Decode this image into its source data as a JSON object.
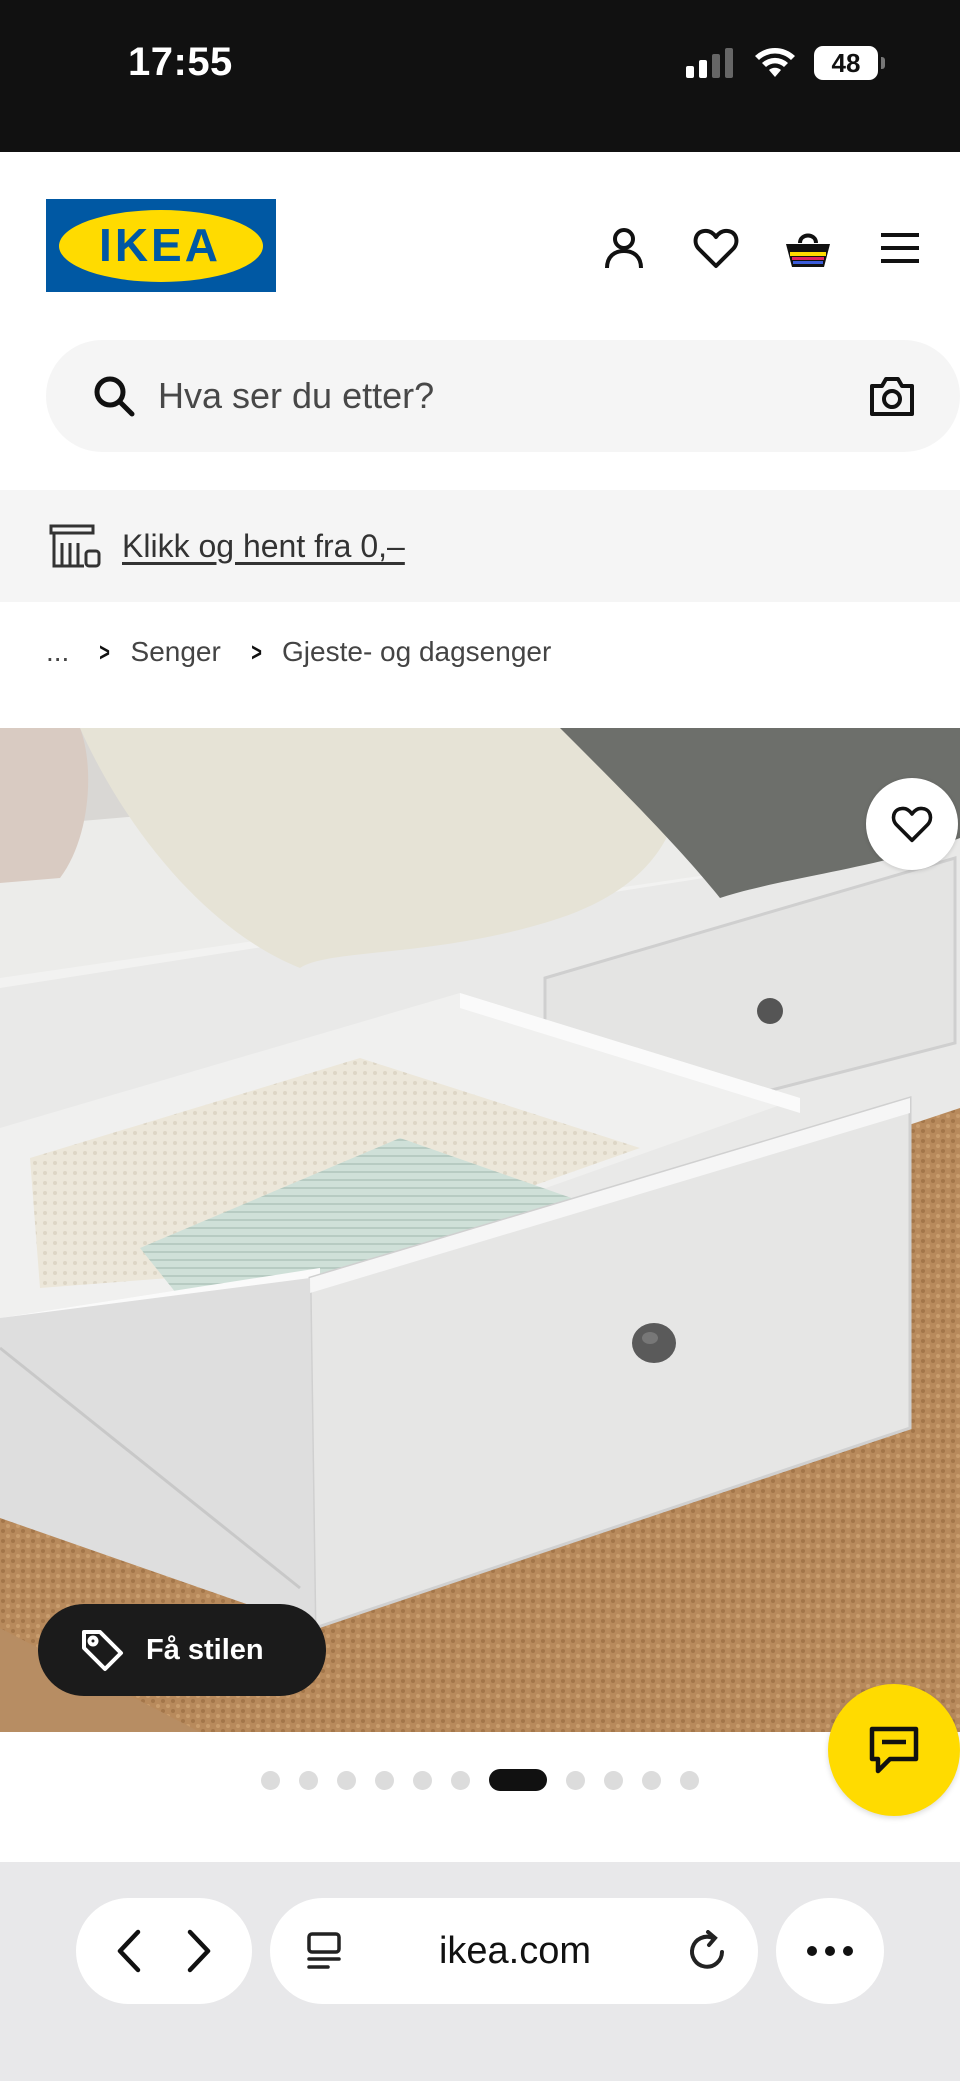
{
  "status_bar": {
    "time": "17:55",
    "battery": "48"
  },
  "header": {
    "logo_text": "IKEA",
    "brand_colors": {
      "blue": "#0058A3",
      "yellow": "#FFDB00"
    }
  },
  "search": {
    "placeholder": "Hva ser du etter?"
  },
  "promo": {
    "link_text": "Klikk og hent fra 0,–"
  },
  "breadcrumb": {
    "items": [
      "...",
      "Senger",
      "Gjeste- og dagsenger"
    ]
  },
  "product": {
    "style_button_label": "Få stilen",
    "image_count": 11,
    "active_image_index": 6
  },
  "browser": {
    "url": "ikea.com"
  }
}
